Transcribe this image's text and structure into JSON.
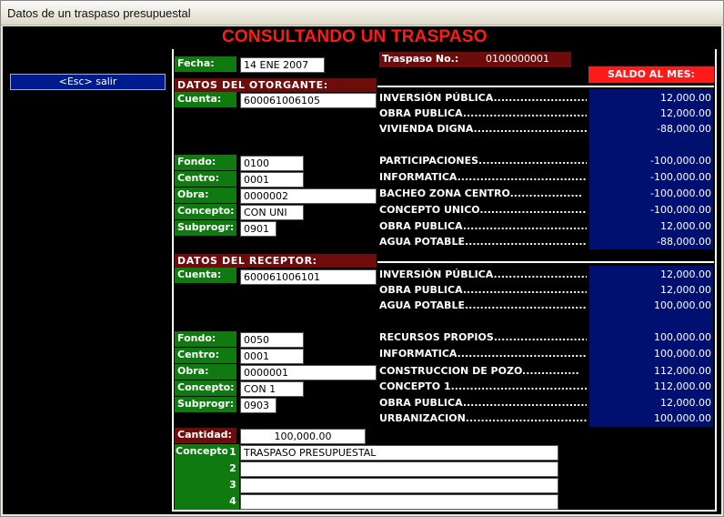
{
  "window": {
    "title": "Datos de un traspaso presupuestal"
  },
  "heading": "CONSULTANDO UN TRASPASO",
  "esc_button": "<Esc> salir",
  "fecha": {
    "label": "Fecha:",
    "value": "14 ENE 2007"
  },
  "traspaso": {
    "label": "Traspaso No.:",
    "value": "0100000001"
  },
  "saldo_label": "SALDO AL MES:",
  "otorgante": {
    "title": "DATOS DEL OTORGANTE:",
    "cuenta_label": "Cuenta:",
    "cuenta": "600061006105",
    "fondo_label": "Fondo:",
    "fondo": "0100",
    "centro_label": "Centro:",
    "centro": "0001",
    "obra_label": "Obra:",
    "obra": "0000002",
    "concepto_label": "Concepto:",
    "concepto": "CON UNI",
    "subprogr_label": "Subprogr:",
    "subprogr": "0901",
    "accounts": [
      {
        "name": "INVERSIÓN PÚBLICA...........................",
        "value": "12,000.00"
      },
      {
        "name": "OBRA PUBLICA...................................",
        "value": "12,000.00"
      },
      {
        "name": "VIVIENDA DIGNA...............................",
        "value": "-88,000.00"
      },
      {
        "name": "PARTICIPACIONES.............................",
        "value": "-100,000.00"
      },
      {
        "name": "INFORMATICA......................................",
        "value": "-100,000.00"
      },
      {
        "name": "BACHEO ZONA CENTRO...................",
        "value": "-100,000.00"
      },
      {
        "name": "CONCEPTO UNICO...............................",
        "value": "-100,000.00"
      },
      {
        "name": "OBRA PUBLICA...................................",
        "value": "12,000.00"
      },
      {
        "name": "AGUA POTABLE..................................",
        "value": "-88,000.00"
      }
    ]
  },
  "receptor": {
    "title": "DATOS DEL RECEPTOR:",
    "cuenta_label": "Cuenta:",
    "cuenta": "600061006101",
    "fondo_label": "Fondo:",
    "fondo": "0050",
    "centro_label": "Centro:",
    "centro": "0001",
    "obra_label": "Obra:",
    "obra": "0000001",
    "concepto_label": "Concepto:",
    "concepto": "CON 1",
    "subprogr_label": "Subprogr:",
    "subprogr": "0903",
    "accounts": [
      {
        "name": "INVERSIÓN PÚBLICA...........................",
        "value": "12,000.00"
      },
      {
        "name": "OBRA PUBLICA...................................",
        "value": "12,000.00"
      },
      {
        "name": "AGUA POTABLE..................................",
        "value": "100,000.00"
      },
      {
        "name": "RECURSOS PROPIOS..........................",
        "value": "100,000.00"
      },
      {
        "name": "INFORMATICA......................................",
        "value": "100,000.00"
      },
      {
        "name": "CONSTRUCCION DE POZO...............",
        "value": "112,000.00"
      },
      {
        "name": "CONCEPTO 1.........................................",
        "value": "112,000.00"
      },
      {
        "name": "OBRA PUBLICA...................................",
        "value": "12,000.00"
      },
      {
        "name": "URBANIZACION....................................",
        "value": "100,000.00"
      }
    ]
  },
  "cantidad": {
    "label": "Cantidad:",
    "value": "100,000.00"
  },
  "concepto_lines": {
    "label": "Concepto:",
    "numbers": [
      "1",
      "2",
      "3",
      "4"
    ],
    "lines": [
      "TRASPASO PRESUPUESTAL",
      "",
      "",
      ""
    ]
  }
}
